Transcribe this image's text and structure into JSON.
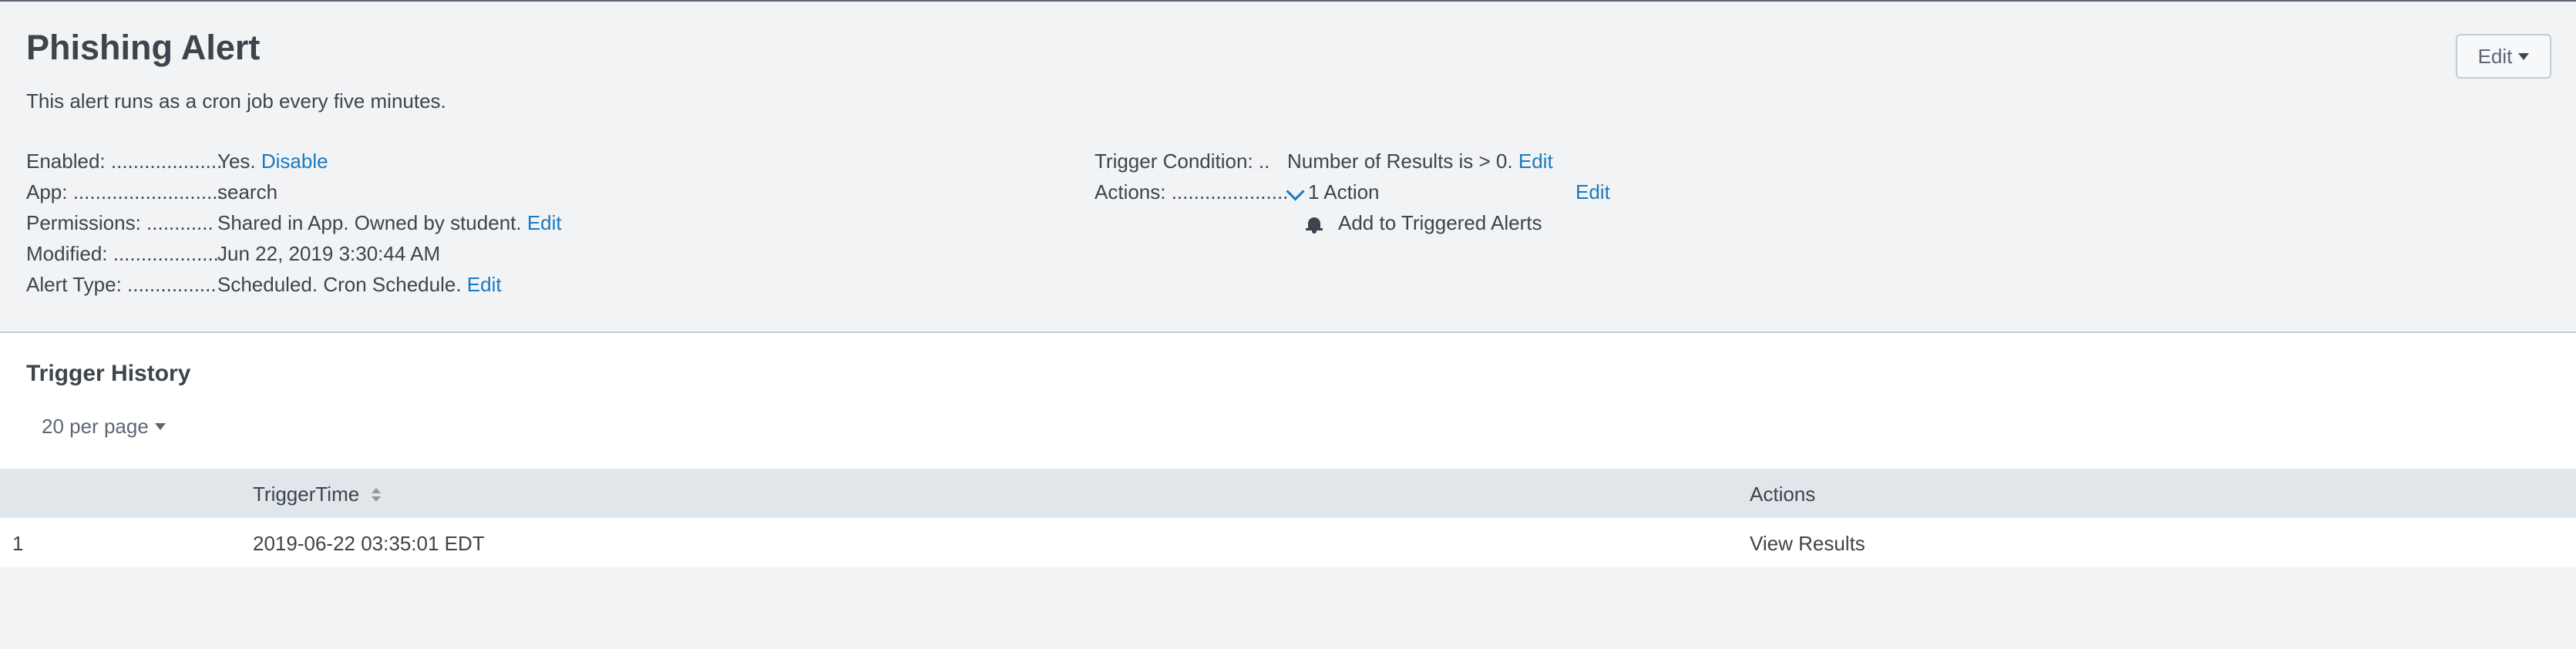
{
  "alert": {
    "title": "Phishing Alert",
    "description": "This alert runs as a cron job every five minutes.",
    "edit_button_label": "Edit"
  },
  "details": {
    "enabled_label": "Enabled: ....................",
    "enabled_value": "Yes.",
    "enabled_link": "Disable",
    "app_label": "App: ...........................",
    "app_value": "search",
    "permissions_label": "Permissions: ............",
    "permissions_value": "Shared in App. Owned by student.",
    "permissions_link": "Edit",
    "modified_label": "Modified: ...................",
    "modified_value": "Jun 22, 2019 3:30:44 AM",
    "alert_type_label": "Alert Type: ................",
    "alert_type_value": "Scheduled. Cron Schedule.",
    "alert_type_link": "Edit"
  },
  "trigger": {
    "condition_label": "Trigger Condition: ..",
    "condition_value": "Number of Results is > 0.",
    "condition_link": "Edit",
    "actions_label": "Actions: .....................",
    "actions_toggle": "1 Action",
    "actions_link": "Edit",
    "action_item": "Add to Triggered Alerts"
  },
  "history": {
    "title": "Trigger History",
    "per_page": "20 per page",
    "columns": [
      "",
      "TriggerTime",
      "Actions"
    ],
    "rows": [
      {
        "index": "1",
        "trigger_time": "2019-06-22 03:35:01 EDT",
        "action": "View Results"
      }
    ]
  },
  "icons": {
    "caret": "caret-down-icon",
    "sort": "sort-icon",
    "bell": "bell-icon",
    "chevron": "chevron-down-icon"
  },
  "colors": {
    "link": "#1a7ac0",
    "header_bg": "#f2f3f4",
    "table_header_bg": "#e1e6eb"
  }
}
